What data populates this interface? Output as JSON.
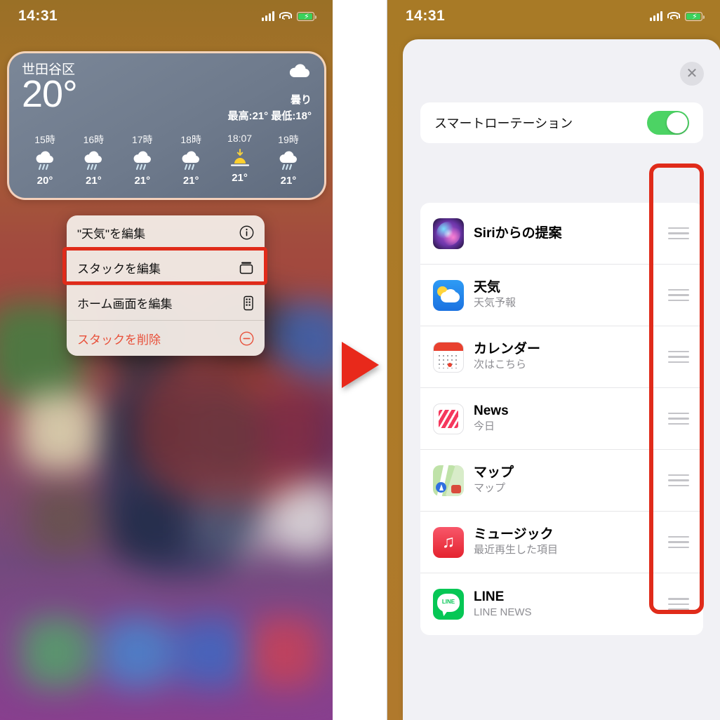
{
  "left_phone": {
    "status_bar": {
      "time": "14:31",
      "signal_icon": "cellular-bars-icon",
      "wifi_icon": "wifi-icon",
      "battery_icon": "battery-charging-icon"
    },
    "weather_widget": {
      "city": "世田谷区",
      "temperature": "20°",
      "condition": "曇り",
      "high_low": "最高:21° 最低:18°",
      "condition_icon": "cloud-icon",
      "hourly": [
        {
          "time": "15時",
          "icon": "rain-cloud-icon",
          "temp": "20°"
        },
        {
          "time": "16時",
          "icon": "rain-cloud-icon",
          "temp": "21°"
        },
        {
          "time": "17時",
          "icon": "rain-cloud-icon",
          "temp": "21°"
        },
        {
          "time": "18時",
          "icon": "rain-cloud-icon",
          "temp": "21°"
        },
        {
          "time": "18:07",
          "icon": "sunset-icon",
          "temp": "21°"
        },
        {
          "time": "19時",
          "icon": "rain-cloud-icon",
          "temp": "21°"
        }
      ]
    },
    "context_menu": {
      "items": [
        {
          "label": "\"天気\"を編集",
          "icon": "info-circle-icon",
          "highlighted": false,
          "destructive": false
        },
        {
          "label": "スタックを編集",
          "icon": "stack-icon",
          "highlighted": true,
          "destructive": false
        },
        {
          "label": "ホーム画面を編集",
          "icon": "phone-edit-icon",
          "highlighted": false,
          "destructive": false
        },
        {
          "label": "スタックを削除",
          "icon": "minus-circle-icon",
          "highlighted": false,
          "destructive": true
        }
      ]
    }
  },
  "arrow": {
    "icon": "play-triangle-arrow-icon",
    "color": "#e8291b"
  },
  "right_phone": {
    "status_bar": {
      "time": "14:31",
      "signal_icon": "cellular-bars-icon",
      "wifi_icon": "wifi-icon",
      "battery_icon": "battery-charging-icon"
    },
    "sheet": {
      "close_icon": "close-icon",
      "smart_rotation": {
        "label": "スマートローテーション",
        "enabled": true,
        "toggle_color": "#4cd364"
      },
      "apps": [
        {
          "title": "Siriからの提案",
          "subtitle": "",
          "icon": "siri-suggestions-app-icon",
          "drag_handle": "drag-handle-icon"
        },
        {
          "title": "天気",
          "subtitle": "天気予報",
          "icon": "weather-app-icon",
          "drag_handle": "drag-handle-icon"
        },
        {
          "title": "カレンダー",
          "subtitle": "次はこちら",
          "icon": "calendar-app-icon",
          "drag_handle": "drag-handle-icon"
        },
        {
          "title": "News",
          "subtitle": "今日",
          "icon": "news-app-icon",
          "drag_handle": "drag-handle-icon"
        },
        {
          "title": "マップ",
          "subtitle": "マップ",
          "icon": "maps-app-icon",
          "drag_handle": "drag-handle-icon"
        },
        {
          "title": "ミュージック",
          "subtitle": "最近再生した項目",
          "icon": "music-app-icon",
          "drag_handle": "drag-handle-icon"
        },
        {
          "title": "LINE",
          "subtitle": "LINE NEWS",
          "icon": "line-app-icon",
          "drag_handle": "drag-handle-icon"
        }
      ]
    },
    "highlight_box": {
      "color": "#e02b1a"
    }
  }
}
